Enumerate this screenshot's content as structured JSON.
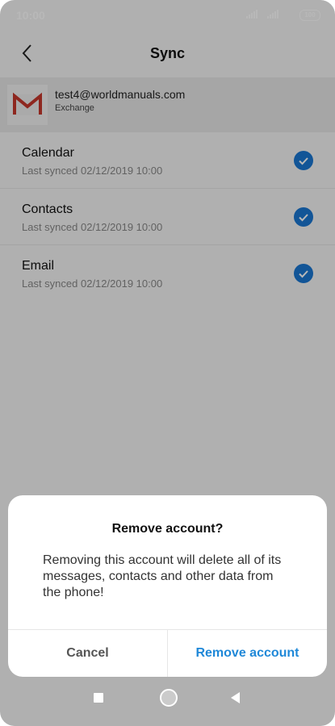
{
  "status_bar": {
    "time": "10:00",
    "battery": "100"
  },
  "header": {
    "title": "Sync",
    "back_icon": "chevron-left-icon"
  },
  "account": {
    "email": "test4@worldmanuals.com",
    "type": "Exchange",
    "icon": "gmail-logo-icon"
  },
  "sync_items": [
    {
      "title": "Calendar",
      "last_synced": "Last synced 02/12/2019 10:00",
      "checked": true
    },
    {
      "title": "Contacts",
      "last_synced": "Last synced 02/12/2019 10:00",
      "checked": true
    },
    {
      "title": "Email",
      "last_synced": "Last synced 02/12/2019 10:00",
      "checked": true
    }
  ],
  "dialog": {
    "title": "Remove account?",
    "message": "Removing this account will delete all of its messages, contacts and other data from the phone!",
    "cancel_label": "Cancel",
    "confirm_label": "Remove account"
  },
  "colors": {
    "accent": "#1f88d8",
    "check": "#1976d2",
    "gmail_red": "#c5372c"
  }
}
